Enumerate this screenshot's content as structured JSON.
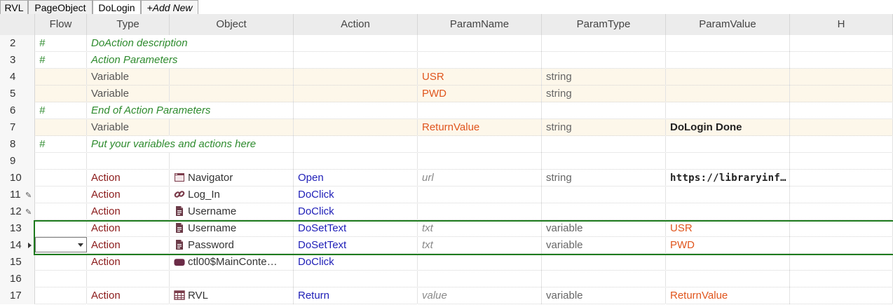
{
  "tabs": [
    {
      "label": "RVL",
      "active": false
    },
    {
      "label": "PageObject",
      "active": false
    },
    {
      "label": "DoLogin",
      "active": true
    },
    {
      "label": "+Add New",
      "active": false
    }
  ],
  "columns": [
    "Flow",
    "Type",
    "Object",
    "Action",
    "ParamName",
    "ParamType",
    "ParamValue",
    "H"
  ],
  "rows": [
    {
      "num": "2",
      "flow": "#",
      "type": "DoAction description",
      "kind": "comment"
    },
    {
      "num": "3",
      "flow": "#",
      "type": "Action Parameters",
      "kind": "comment"
    },
    {
      "num": "4",
      "type": "Variable",
      "paramName": "USR",
      "paramType": "string",
      "kind": "var"
    },
    {
      "num": "5",
      "type": "Variable",
      "paramName": "PWD",
      "paramType": "string",
      "kind": "var"
    },
    {
      "num": "6",
      "flow": "#",
      "type": "End of Action Parameters",
      "kind": "comment"
    },
    {
      "num": "7",
      "type": "Variable",
      "paramName": "ReturnValue",
      "paramType": "string",
      "paramValue": "DoLogin Done",
      "kind": "var"
    },
    {
      "num": "8",
      "flow": "#",
      "type": "Put your variables and actions here",
      "kind": "comment"
    },
    {
      "num": "9",
      "kind": "empty"
    },
    {
      "num": "10",
      "type": "Action",
      "objectIcon": "window-icon",
      "object": "Navigator",
      "action": "Open",
      "paramName": "url",
      "paramType": "string",
      "paramValue": "https://libraryinformationsystem…",
      "kind": "action"
    },
    {
      "num": "11",
      "type": "Action",
      "objectIcon": "link-icon",
      "object": "Log_In",
      "action": "DoClick",
      "kind": "action",
      "edited": true
    },
    {
      "num": "12",
      "type": "Action",
      "objectIcon": "document-icon",
      "object": "Username",
      "action": "DoClick",
      "kind": "action",
      "edited": true
    },
    {
      "num": "13",
      "type": "Action",
      "objectIcon": "document-icon",
      "object": "Username",
      "action": "DoSetText",
      "paramName": "txt",
      "paramType": "variable",
      "paramValue": "USR",
      "kind": "action"
    },
    {
      "num": "14",
      "type": "Action",
      "objectIcon": "document-icon",
      "object": "Password",
      "action": "DoSetText",
      "paramName": "txt",
      "paramType": "variable",
      "paramValue": "PWD",
      "kind": "action",
      "current": true
    },
    {
      "num": "15",
      "type": "Action",
      "objectIcon": "button-icon",
      "object": "ctl00$MainConte…",
      "action": "DoClick",
      "kind": "action"
    },
    {
      "num": "16",
      "kind": "empty"
    },
    {
      "num": "17",
      "type": "Action",
      "objectIcon": "table-icon",
      "object": "RVL",
      "action": "Return",
      "paramName": "value",
      "paramType": "variable",
      "paramValue": "ReturnValue",
      "kind": "action"
    }
  ],
  "colors": {
    "comment": "#2e8b2e",
    "action_type": "#8b1a1a",
    "method": "#2020b8",
    "param": "#e0551d",
    "selection_border": "#1e7b1e",
    "variable_row_bg": "#fdf7ea"
  }
}
